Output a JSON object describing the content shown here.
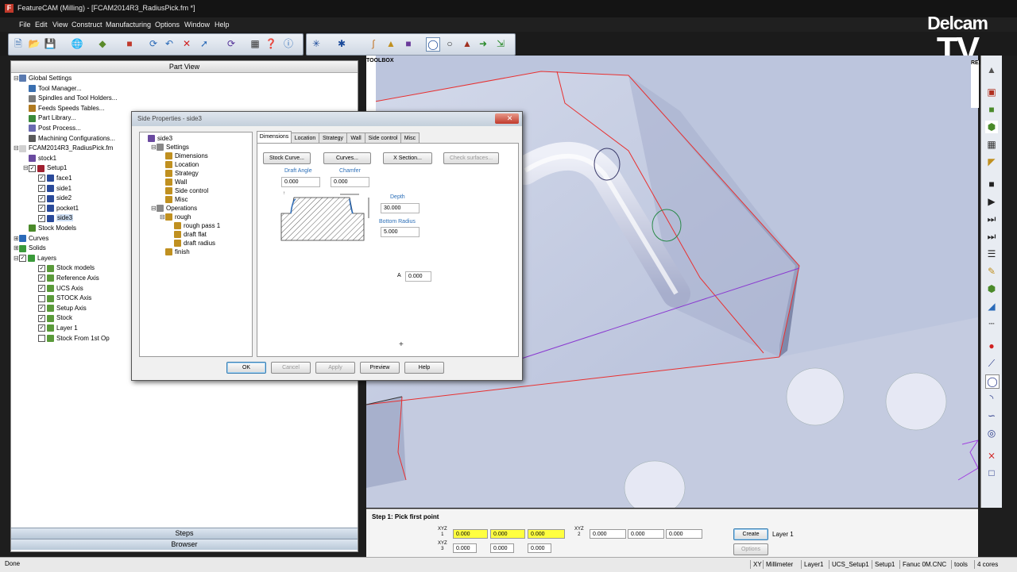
{
  "window": {
    "title": "FeatureCAM (Milling) - [FCAM2014R3_RadiusPick.fm *]"
  },
  "menu": [
    "File",
    "Edit",
    "View",
    "Construct",
    "Manufacturing",
    "Options",
    "Window",
    "Help"
  ],
  "logo": {
    "line1": "Delcam",
    "line2": "TV"
  },
  "part_view": {
    "header": "Part View",
    "tree": [
      {
        "label": "Global Settings",
        "depth": 0,
        "expander": "⊟",
        "checkbox": null,
        "icon": "folder-icon"
      },
      {
        "label": "Tool Manager...",
        "depth": 1,
        "expander": "",
        "checkbox": null,
        "icon": "tool-manager-icon"
      },
      {
        "label": "Spindles and Tool Holders...",
        "depth": 1,
        "expander": "",
        "checkbox": null,
        "icon": "spindle-icon"
      },
      {
        "label": "Feeds  Speeds Tables...",
        "depth": 1,
        "expander": "",
        "checkbox": null,
        "icon": "table-icon"
      },
      {
        "label": "Part Library...",
        "depth": 1,
        "expander": "",
        "checkbox": null,
        "icon": "library-icon"
      },
      {
        "label": "Post Process...",
        "depth": 1,
        "expander": "",
        "checkbox": null,
        "icon": "post-process-icon"
      },
      {
        "label": "Machining Configurations...",
        "depth": 1,
        "expander": "",
        "checkbox": null,
        "icon": "machine-config-icon"
      },
      {
        "label": "FCAM2014R3_RadiusPick.fm",
        "depth": 0,
        "expander": "⊟",
        "checkbox": null,
        "icon": "document-icon"
      },
      {
        "label": "stock1",
        "depth": 1,
        "expander": "",
        "checkbox": null,
        "icon": "stock-icon"
      },
      {
        "label": "Setup1",
        "depth": 1,
        "expander": "⊟",
        "checkbox": "✓",
        "icon": "setup-icon"
      },
      {
        "label": "face1",
        "depth": 2,
        "expander": "",
        "checkbox": "✓",
        "icon": "feature-icon"
      },
      {
        "label": "side1",
        "depth": 2,
        "expander": "",
        "checkbox": "✓",
        "icon": "feature-icon"
      },
      {
        "label": "side2",
        "depth": 2,
        "expander": "",
        "checkbox": "✓",
        "icon": "feature-icon"
      },
      {
        "label": "pocket1",
        "depth": 2,
        "expander": "",
        "checkbox": "✓",
        "icon": "feature-icon"
      },
      {
        "label": "side3",
        "depth": 2,
        "expander": "",
        "checkbox": "✓",
        "icon": "feature-icon",
        "selected": true
      },
      {
        "label": "Stock Models",
        "depth": 1,
        "expander": "",
        "checkbox": null,
        "icon": "stock-models-icon"
      },
      {
        "label": "Curves",
        "depth": 0,
        "expander": "⊞",
        "checkbox": null,
        "icon": "curves-icon"
      },
      {
        "label": "Solids",
        "depth": 0,
        "expander": "⊞",
        "checkbox": null,
        "icon": "solids-icon"
      },
      {
        "label": "Layers",
        "depth": 0,
        "expander": "⊟",
        "checkbox": "✓",
        "icon": "layers-icon"
      },
      {
        "label": "Stock models",
        "depth": 2,
        "expander": "",
        "checkbox": "✓",
        "icon": "layer-icon"
      },
      {
        "label": "Reference Axis",
        "depth": 2,
        "expander": "",
        "checkbox": "✓",
        "icon": "layer-icon"
      },
      {
        "label": "UCS Axis",
        "depth": 2,
        "expander": "",
        "checkbox": "✓",
        "icon": "layer-icon"
      },
      {
        "label": "STOCK Axis",
        "depth": 2,
        "expander": "",
        "checkbox": "",
        "icon": "layer-icon"
      },
      {
        "label": "Setup Axis",
        "depth": 2,
        "expander": "",
        "checkbox": "✓",
        "icon": "layer-icon"
      },
      {
        "label": "Stock",
        "depth": 2,
        "expander": "",
        "checkbox": "✓",
        "icon": "layer-icon"
      },
      {
        "label": "Layer 1",
        "depth": 2,
        "expander": "",
        "checkbox": "✓",
        "icon": "layer-icon"
      },
      {
        "label": "Stock From 1st Op",
        "depth": 2,
        "expander": "",
        "checkbox": "",
        "icon": "layer-icon"
      }
    ],
    "steps_label": "Steps",
    "browser_label": "Browser"
  },
  "toolbox_tab": "TOOLBOX",
  "results_tab": "RESULTS",
  "dialog": {
    "title": "Side Properties - side3",
    "close": "✕",
    "tree": [
      {
        "label": "side3",
        "depth": 0,
        "expander": ""
      },
      {
        "label": "Settings",
        "depth": 1,
        "expander": "⊟"
      },
      {
        "label": "Dimensions",
        "depth": 2,
        "expander": ""
      },
      {
        "label": "Location",
        "depth": 2,
        "expander": ""
      },
      {
        "label": "Strategy",
        "depth": 2,
        "expander": ""
      },
      {
        "label": "Wall",
        "depth": 2,
        "expander": ""
      },
      {
        "label": "Side control",
        "depth": 2,
        "expander": ""
      },
      {
        "label": "Misc",
        "depth": 2,
        "expander": ""
      },
      {
        "label": "Operations",
        "depth": 1,
        "expander": "⊟"
      },
      {
        "label": "rough",
        "depth": 2,
        "expander": "⊟"
      },
      {
        "label": "rough pass 1",
        "depth": 3,
        "expander": ""
      },
      {
        "label": "draft flat",
        "depth": 3,
        "expander": ""
      },
      {
        "label": "draft radius",
        "depth": 3,
        "expander": ""
      },
      {
        "label": "finish",
        "depth": 2,
        "expander": ""
      }
    ],
    "tabs": [
      "Dimensions",
      "Location",
      "Strategy",
      "Wall",
      "Side control",
      "Misc"
    ],
    "active_tab": "Dimensions",
    "buttons": {
      "stock_curve": "Stock Curve...",
      "curves": "Curves...",
      "x_section": "X Section...",
      "check_surfaces": "Check surfaces..."
    },
    "fields": {
      "draft_angle": {
        "label": "Draft Angle",
        "value": "0.000"
      },
      "chamfer": {
        "label": "Chamfer",
        "value": "0.000"
      },
      "depth": {
        "label": "Depth",
        "value": "30.000"
      },
      "bottom_radius": {
        "label": "Bottom Radius",
        "value": "5.000"
      },
      "a": {
        "label": "A",
        "value": "0.000"
      }
    },
    "footer": {
      "ok": "OK",
      "cancel": "Cancel",
      "apply": "Apply",
      "preview": "Preview",
      "help": "Help"
    }
  },
  "step_panel": {
    "title": "Step 1: Pick first point",
    "xyz1_label": "XYZ\n1",
    "xyz2_label": "XYZ\n2",
    "xyz3_label": "XYZ\n3",
    "xyz1": [
      "0.000",
      "0.000",
      "0.000"
    ],
    "xyz2": [
      "0.000",
      "0.000",
      "0.000"
    ],
    "xyz3": [
      "0.000",
      "0.000",
      "0.000"
    ],
    "create": "Create",
    "options": "Options",
    "layer": "Layer 1"
  },
  "status": {
    "left": "Done",
    "items": [
      "XY",
      "Millimeter",
      "Layer1",
      "UCS_Setup1",
      "Setup1",
      "Fanuc 0M.CNC",
      "tools",
      "4 cores"
    ]
  },
  "colors": {
    "viewport_bg": "#bcc5dd",
    "input_highlight": "#ffff40",
    "edge_red": "#e83030"
  }
}
